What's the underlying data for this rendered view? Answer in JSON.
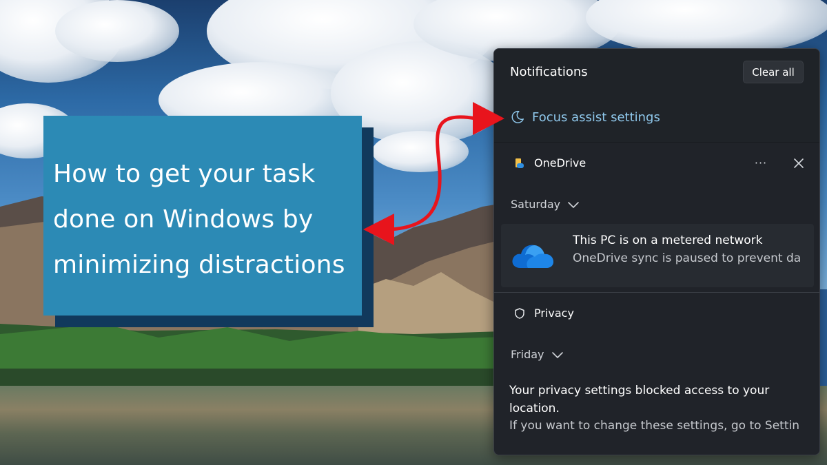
{
  "title_card": {
    "lines": [
      "How to get your task",
      "done on Windows by",
      "minimizing distractions"
    ]
  },
  "notifications_panel": {
    "title": "Notifications",
    "clear_all_label": "Clear all",
    "focus_assist_label": "Focus assist settings",
    "groups": [
      {
        "app": "OneDrive",
        "icon": "onedrive-app-icon",
        "more_label": "···",
        "date": "Saturday",
        "notification": {
          "title": "This PC is on a metered network",
          "body": "OneDrive sync is paused to prevent da"
        }
      },
      {
        "app": "Privacy",
        "icon": "shield-icon",
        "date": "Friday",
        "notification": {
          "title": "Your privacy settings blocked access to your location.",
          "body": "If you want to change these settings, go to Settin"
        }
      }
    ]
  },
  "colors": {
    "card_bg": "#2c8ab5",
    "card_shadow": "#11395c",
    "panel_bg": "#202329",
    "focus_link": "#8fc8ec",
    "arrow": "#e8141c"
  }
}
